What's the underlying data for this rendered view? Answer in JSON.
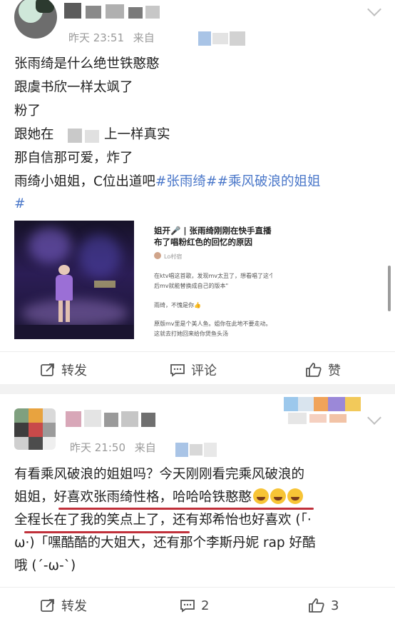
{
  "post1": {
    "time": "昨天 23:51",
    "source_prefix": "来自",
    "lines": [
      "张雨绮是什么绝世铁憨憨",
      "跟虞书欣一样太飒了",
      "粉了",
      "跟她在",
      "上一样真实",
      "那自信那可爱，炸了",
      "雨绮小姐姐，C位出道吧"
    ],
    "topic1": "#张雨绮#",
    "topic2": "#乘风破浪的姐姐",
    "topic2_end": "#",
    "image_title": "姐开🎤 | 张雨绮刚刚在快手直播布了唱粉红色的回忆的原因",
    "image_lines": [
      "在ktv唱这首歌，发现mv太丑了，想看唱了这个",
      "后mv就能替换成自己的版本\"",
      "雨绮，不愧是你👍",
      "原版mv里是个美人鱼。姐你在此地不要走动。",
      "这就去打她回来给你煲鱼头汤"
    ],
    "image_author": "Lo村宿",
    "repost_label": "转发",
    "comment_label": "评论",
    "like_label": "赞"
  },
  "post2": {
    "time": "昨天 21:50",
    "source_prefix": "来自",
    "line1": "有看乘风破浪的姐姐吗？今天刚刚看完乘风破浪的",
    "line2a": "姐姐，",
    "line2b": "好喜欢张雨绮性格，哈哈哈铁憨憨",
    "line3a": "全程长在了我的笑点上了",
    "line3b": "，还有郑希怡也好喜欢 (「·",
    "line4": "ω·)「嘿酷酷的大姐大，还有那个李斯丹妮 rap 好酷",
    "line5": "哦 (´-ω-`)",
    "repost_label": "转发",
    "comment_count": "2",
    "like_count": "3"
  },
  "colors": {
    "topic": "#4a77c9",
    "underline": "#c0303a",
    "meta": "#9a9a9a"
  },
  "icons": [
    "chevron-down-icon",
    "repost-icon",
    "comment-icon",
    "like-icon",
    "laugh-cry-emoji"
  ]
}
